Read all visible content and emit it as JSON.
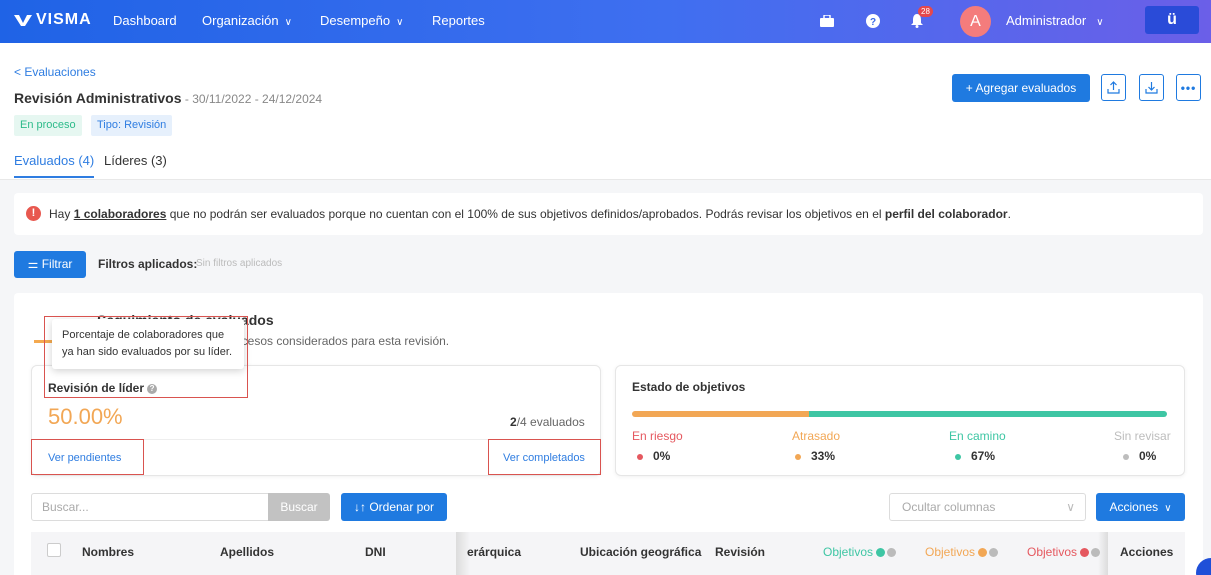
{
  "nav": {
    "logo": "VISMA",
    "items": [
      {
        "label": "Dashboard"
      },
      {
        "label": "Organización"
      },
      {
        "label": "Desempeño"
      },
      {
        "label": "Reportes"
      }
    ],
    "notifications_count": "28",
    "avatar_initial": "A",
    "user": "Administrador",
    "app_button": "ü"
  },
  "header": {
    "back": "< Evaluaciones",
    "title": "Revisión Administrativos",
    "dates": " - 30/11/2022 - 24/12/2024",
    "tags": [
      "En proceso",
      "Tipo: Revisión"
    ],
    "tabs": [
      "Evaluados (4)",
      "Líderes (3)"
    ],
    "add_button": "+ Agregar evaluados"
  },
  "alert": {
    "prefix": "Hay ",
    "link": "1 colaboradores",
    "middle": " que no podrán ser evaluados porque no cuentan con el 100% de sus objetivos definidos/aprobados. Podrás revisar los objetivos en el ",
    "bold": "perfil del colaborador",
    "suffix": "."
  },
  "filters": {
    "button": "Filtrar",
    "label": "Filtros aplicados:",
    "value": "Sin filtros aplicados"
  },
  "tracking": {
    "title": "Seguimiento de evaluados",
    "subtitle": "ocesos considerados para esta revisión.",
    "tooltip": "Porcentaje de colaboradores que ya han sido evaluados por su líder.",
    "leader_label": "Revisión de líder",
    "percent": "50.00%",
    "evaluated_done": "2",
    "evaluated_total": "/4 evaluados",
    "link_pending": "Ver pendientes",
    "link_done": "Ver completados"
  },
  "objectives": {
    "title": "Estado de objetivos",
    "states": [
      {
        "label": "En riesgo",
        "value": "0%",
        "color": "#e5585f"
      },
      {
        "label": "Atrasado",
        "value": "33%",
        "color": "#f2a755"
      },
      {
        "label": "En camino",
        "value": "67%",
        "color": "#3ec6a4"
      },
      {
        "label": "Sin revisar",
        "value": "0%",
        "color": "#bdbdbd"
      }
    ],
    "bar_fractions": {
      "atrasado": 0.33,
      "en_camino": 0.67
    }
  },
  "toolbar": {
    "search_placeholder": "Buscar...",
    "search_button": "Buscar",
    "order_button": "Ordenar por",
    "hide_columns": "Ocultar columnas",
    "actions": "Acciones"
  },
  "table": {
    "headers": [
      "Nombres",
      "Apellidos",
      "DNI",
      "erárquica",
      "Ubicación geográfica",
      "Revisión",
      "Objetivos",
      "Objetivos",
      "Objetivos",
      "Acciones"
    ]
  }
}
